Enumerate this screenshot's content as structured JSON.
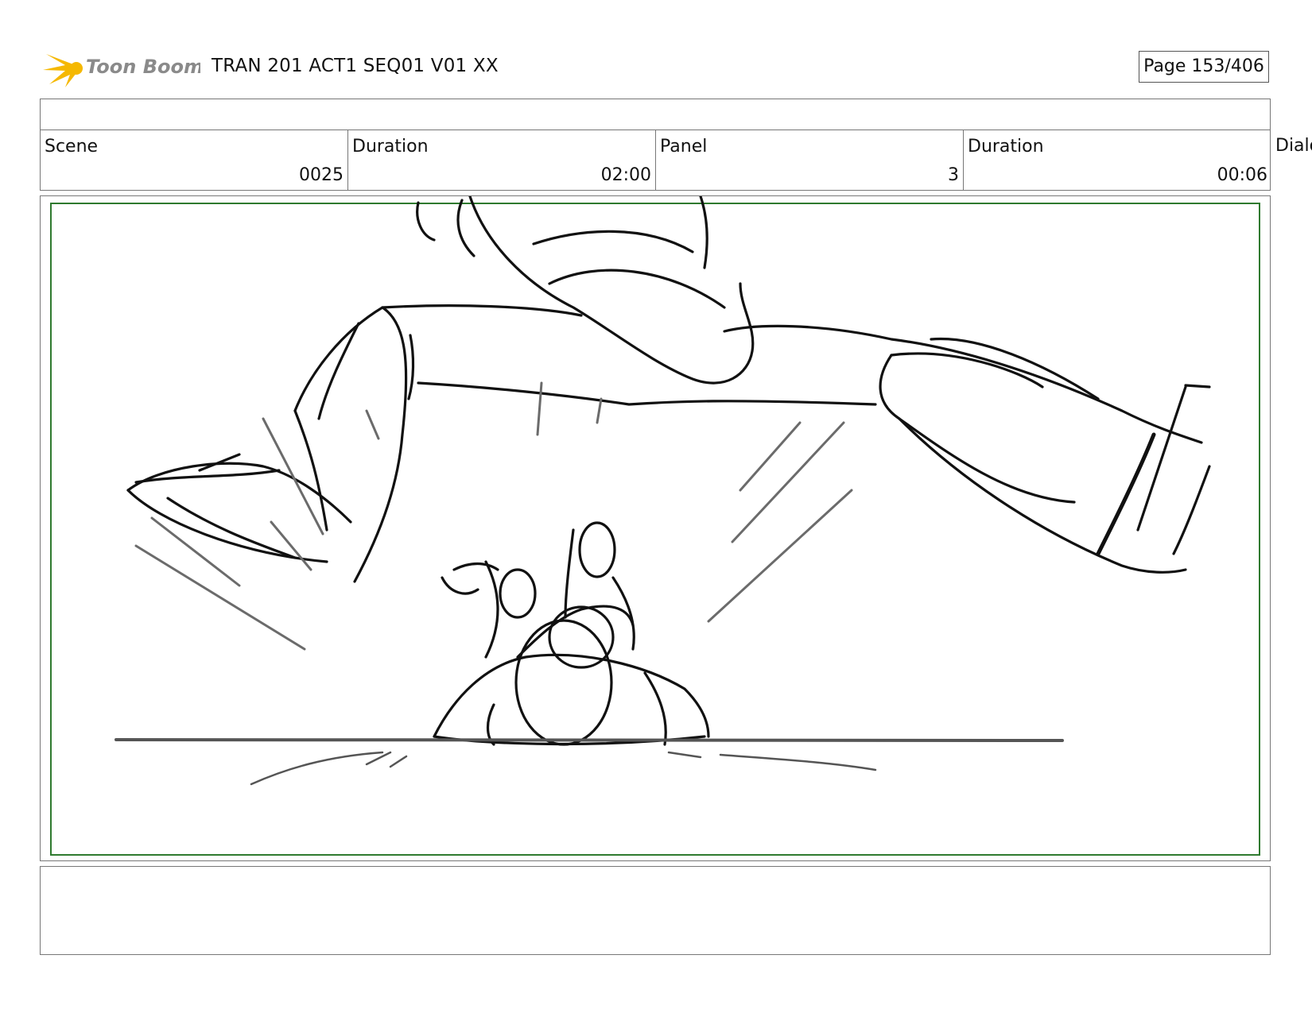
{
  "header": {
    "logo_text": "Toon Boom",
    "title": "TRAN 201 ACT1 SEQ01 V01 XX",
    "page": "Page 153/406"
  },
  "fields": [
    {
      "label": "Scene",
      "value": "0025"
    },
    {
      "label": "Duration",
      "value": "02:00"
    },
    {
      "label": "Panel",
      "value": "3"
    },
    {
      "label": "Duration",
      "value": "00:06"
    }
  ],
  "overflow_label": "Dialo",
  "colors": {
    "safe_area_border": "#2f7a2f",
    "logo_burst": "#f5b800",
    "logo_text": "#8a8a8a"
  }
}
